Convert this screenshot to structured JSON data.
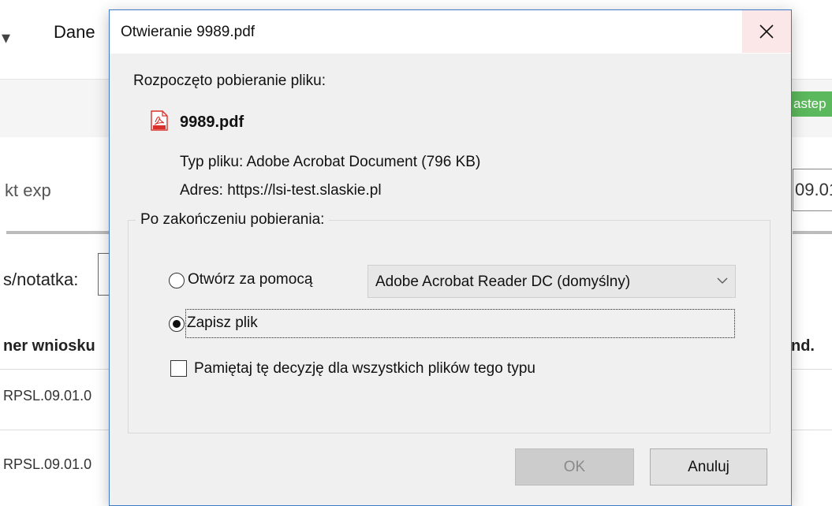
{
  "background": {
    "nav_item": "Dane",
    "green_button": "astep",
    "left_text": "kt exp",
    "right_input": "09.01",
    "notatka_label": "s/notatka:",
    "table_header_left": "ner wniosku",
    "table_header_right": "nd.",
    "rows": [
      "RPSL.09.01.0",
      "RPSL.09.01.0"
    ]
  },
  "dialog": {
    "title": "Otwieranie 9989.pdf",
    "start_label": "Rozpoczęto pobieranie pliku:",
    "file_name": "9989.pdf",
    "file_type_line": "Typ pliku:  Adobe Acrobat Document (796 KB)",
    "address_line": "Adres:  https://lsi-test.slaskie.pl",
    "group_label": "Po zakończeniu pobierania:",
    "open_with_label": "Otwórz za pomocą",
    "open_with_app": "Adobe Acrobat Reader DC  (domyślny)",
    "save_label": "Zapisz plik",
    "remember_label": "Pamiętaj tę decyzję dla wszystkich plików tego typu",
    "ok_label": "OK",
    "cancel_label": "Anuluj",
    "selected_action": "save",
    "remember_checked": false
  },
  "icons": {
    "close": "close-icon",
    "pdf": "pdf-file-icon",
    "dropdown": "chevron-down-icon"
  },
  "colors": {
    "dialog_border": "#3d7bc9",
    "close_hover_bg": "#fbe7e8",
    "pdf_red": "#d9302c",
    "background_green": "#5cb85c"
  }
}
